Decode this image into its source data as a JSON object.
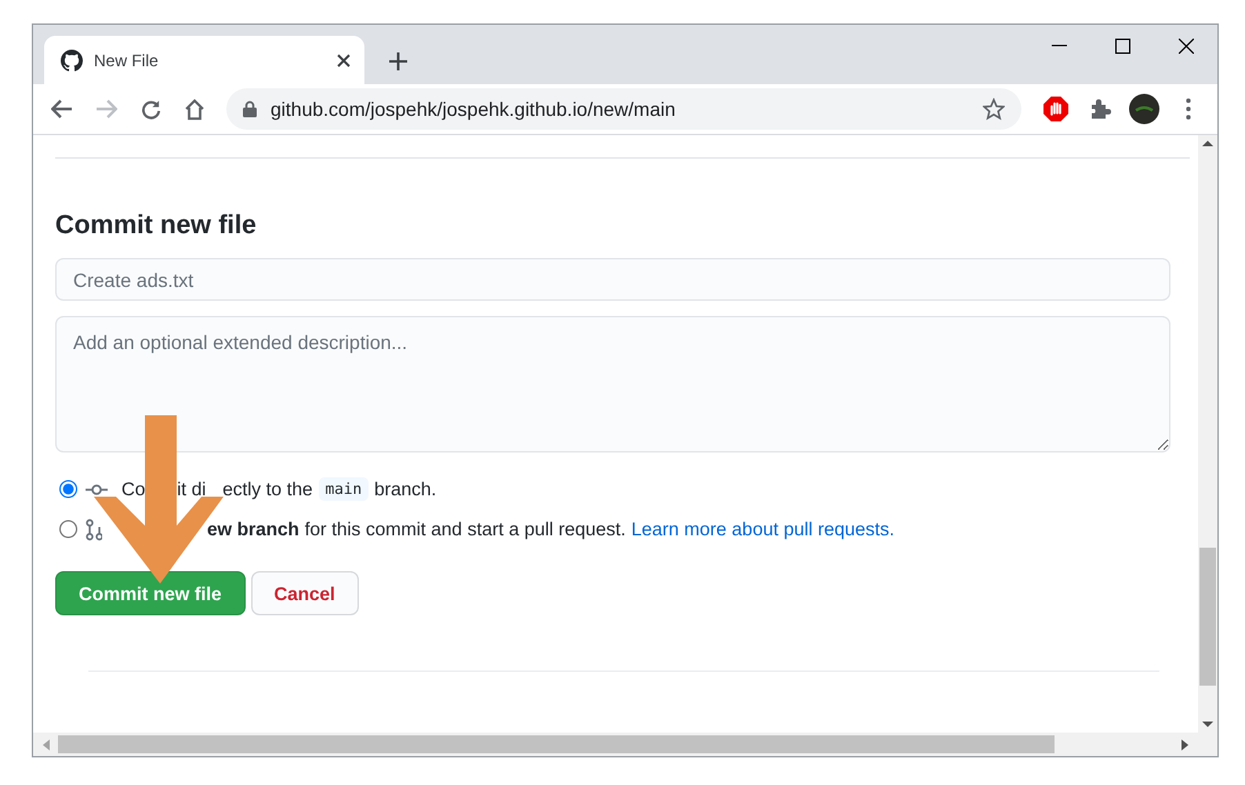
{
  "browser": {
    "tabs": [
      {
        "title": "New File",
        "selected": true
      }
    ],
    "address": "github.com/jospehk/jospehk.github.io/new/main"
  },
  "commit": {
    "heading": "Commit new file",
    "summary": {
      "placeholder": "Create ads.txt"
    },
    "description": {
      "placeholder": "Add an optional extended description..."
    },
    "options": [
      {
        "kind": "direct",
        "selected": true,
        "segments": [
          {
            "kind": "text",
            "text": "Co"
          },
          {
            "kind": "text",
            "text": "it di"
          },
          {
            "kind": "text",
            "text": "ectly to the"
          },
          {
            "kind": "code",
            "text": "main"
          },
          {
            "kind": "text",
            "text": "branch."
          }
        ]
      },
      {
        "kind": "new_branch",
        "selected": false,
        "segments": [
          {
            "kind": "bold",
            "text": "ew branch"
          },
          {
            "kind": "text",
            "text": "for this commit and start a pull request."
          },
          {
            "kind": "link",
            "text": "Learn more about pull requests."
          }
        ]
      }
    ],
    "buttons": [
      {
        "kind": "primary",
        "label": "Commit new file"
      },
      {
        "kind": "cancel",
        "label": "Cancel"
      }
    ]
  }
}
